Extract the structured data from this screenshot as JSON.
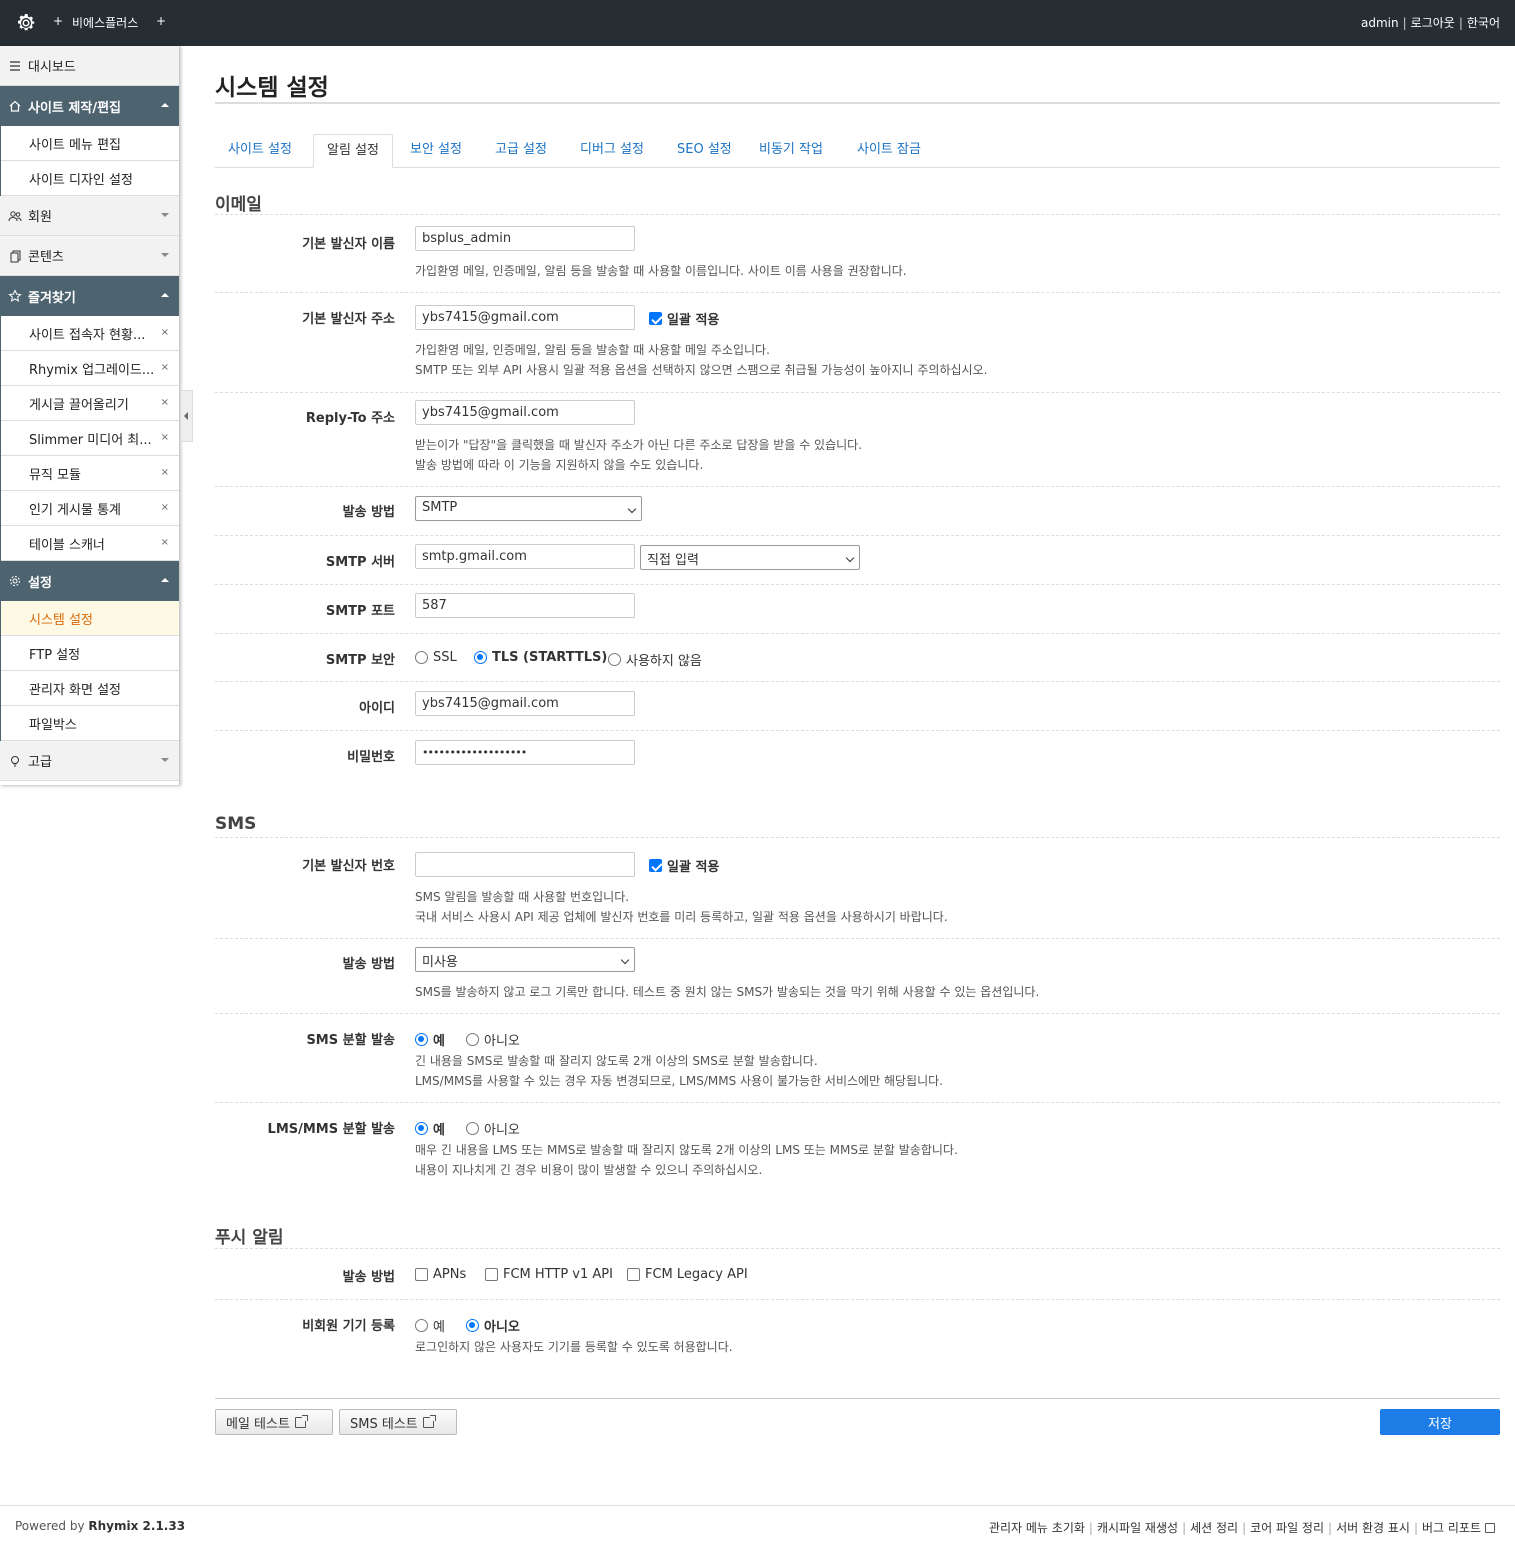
{
  "header": {
    "site_name": "비에스플러스",
    "plus_left": "+",
    "plus_right": "+",
    "user": "admin",
    "logout": "로그아웃",
    "language": "한국어",
    "sep": "|"
  },
  "sidebar": {
    "dashboard": "대시보드",
    "groups": [
      {
        "label": "사이트 제작/편집",
        "items": [
          "사이트 메뉴 편집",
          "사이트 디자인 설정"
        ]
      },
      {
        "label": "회원"
      },
      {
        "label": "콘텐츠"
      },
      {
        "label": "즐겨찾기",
        "items": [
          "사이트 접속자 현황...",
          "Rhymix 업그레이드...",
          "게시글 끌어올리기",
          "Slimmer 미디어 최...",
          "뮤직 모듈",
          "인기 게시물 통계",
          "테이블 스캐너"
        ]
      },
      {
        "label": "설정",
        "items": [
          "시스템 설정",
          "FTP 설정",
          "관리자 화면 설정",
          "파일박스"
        ]
      },
      {
        "label": "고급"
      }
    ],
    "delete_mark": "×"
  },
  "page": {
    "title": "시스템 설정",
    "tabs": [
      "사이트 설정",
      "알림 설정",
      "보안 설정",
      "고급 설정",
      "디버그 설정",
      "SEO 설정",
      "비동기 작업",
      "사이트 잠금"
    ],
    "active_tab": "알림 설정"
  },
  "email": {
    "section_title": "이메일",
    "sender_name_label": "기본 발신자 이름",
    "sender_name_value": "bsplus_admin",
    "sender_name_help": "가입환영 메일, 인증메일, 알림 등을 발송할 때 사용할 이름입니다. 사이트 이름 사용을 권장합니다.",
    "sender_addr_label": "기본 발신자 주소",
    "sender_addr_value": "ybs7415@gmail.com",
    "force_apply": "일괄 적용",
    "sender_addr_help1": "가입환영 메일, 인증메일, 알림 등을 발송할 때 사용할 메일 주소입니다.",
    "sender_addr_help2": "SMTP 또는 외부 API 사용시 일괄 적용 옵션을 선택하지 않으면 스팸으로 취급될 가능성이 높아지니 주의하십시오.",
    "reply_to_label": "Reply-To 주소",
    "reply_to_value": "ybs7415@gmail.com",
    "reply_to_help1": "받는이가 \"답장\"을 클릭했을 때 발신자 주소가 아닌 다른 주소로 답장을 받을 수 있습니다.",
    "reply_to_help2": "발송 방법에 따라 이 기능을 지원하지 않을 수도 있습니다.",
    "method_label": "발송 방법",
    "method_value": "SMTP",
    "smtp_server_label": "SMTP 서버",
    "smtp_server_value": "smtp.gmail.com",
    "smtp_server_preset": "직접 입력",
    "smtp_port_label": "SMTP 포트",
    "smtp_port_value": "587",
    "smtp_security_label": "SMTP 보안",
    "smtp_security_options": [
      "SSL",
      "TLS (STARTTLS)",
      "사용하지 않음"
    ],
    "smtp_security_selected": "TLS (STARTTLS)",
    "id_label": "아이디",
    "id_value": "ybs7415@gmail.com",
    "password_label": "비밀번호",
    "password_value": "•••••••••••••••••••"
  },
  "sms": {
    "section_title": "SMS",
    "sender_num_label": "기본 발신자 번호",
    "sender_num_value": "",
    "force_apply": "일괄 적용",
    "sender_num_help1": "SMS 알림을 발송할 때 사용할 번호입니다.",
    "sender_num_help2": "국내 서비스 사용시 API 제공 업체에 발신자 번호를 미리 등록하고, 일괄 적용 옵션을 사용하시기 바랍니다.",
    "method_label": "발송 방법",
    "method_value": "미사용",
    "method_help": "SMS를 발송하지 않고 로그 기록만 합니다. 테스트 중 원치 않는 SMS가 발송되는 것을 막기 위해 사용할 수 있는 옵션입니다.",
    "split_label": "SMS 분할 발송",
    "yes": "예",
    "no": "아니오",
    "split_help1": "긴 내용을 SMS로 발송할 때 잘리지 않도록 2개 이상의 SMS로 분할 발송합니다.",
    "split_help2": "LMS/MMS를 사용할 수 있는 경우 자동 변경되므로, LMS/MMS 사용이 불가능한 서비스에만 해당됩니다.",
    "lms_split_label": "LMS/MMS 분할 발송",
    "lms_split_help1": "매우 긴 내용을 LMS 또는 MMS로 발송할 때 잘리지 않도록 2개 이상의 LMS 또는 MMS로 분할 발송합니다.",
    "lms_split_help2": "내용이 지나치게 긴 경우 비용이 많이 발생할 수 있으니 주의하십시오."
  },
  "push": {
    "section_title": "푸시 알림",
    "method_label": "발송 방법",
    "methods": [
      "APNs",
      "FCM HTTP v1 API",
      "FCM Legacy API"
    ],
    "guest_label": "비회원 기기 등록",
    "yes": "예",
    "no": "아니오",
    "guest_help": "로그인하지 않은 사용자도 기기를 등록할 수 있도록 허용합니다."
  },
  "buttons": {
    "mail_test": "메일 테스트",
    "sms_test": "SMS 테스트",
    "save": "저장"
  },
  "footer": {
    "powered_by": "Powered by",
    "version": "Rhymix 2.1.33",
    "links": [
      "관리자 메뉴 초기화",
      "캐시파일 재생성",
      "세션 정리",
      "코어 파일 정리",
      "서버 환경 표시",
      "버그 리포트"
    ],
    "sep": "|"
  },
  "colors": {
    "topbar": "#262d33",
    "sidebar_open": "#4d6370",
    "link": "#1a73c4",
    "primary": "#1e7ce6",
    "active_menu": "#d86a0b"
  }
}
